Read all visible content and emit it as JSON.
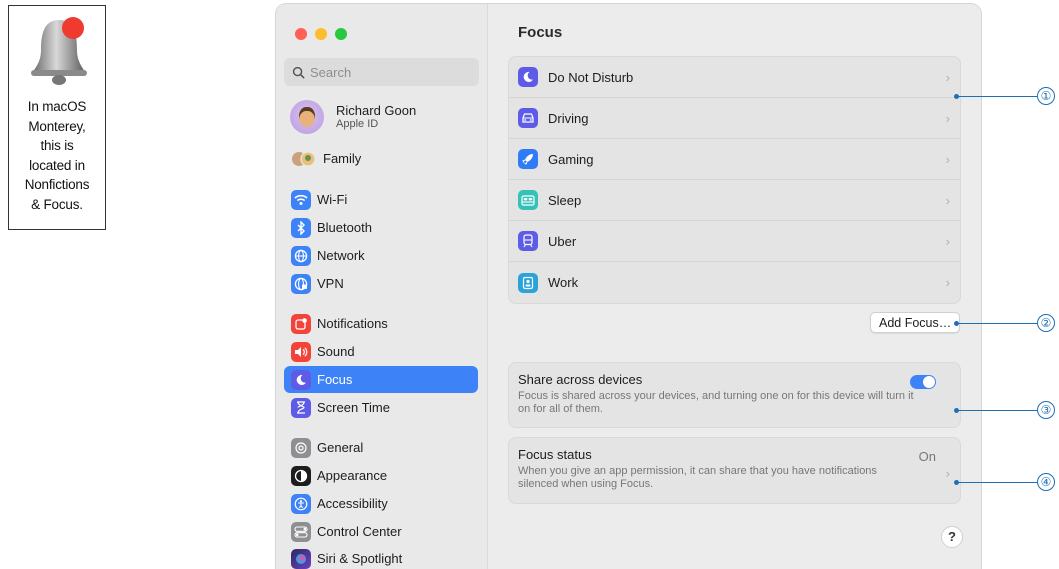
{
  "callout": {
    "text": "In macOS\nMonterey,\nthis is\nlocated in\nNonfictions\n& Focus."
  },
  "window": {
    "search_placeholder": "Search",
    "profile": {
      "name": "Richard Goon",
      "sub": "Apple ID"
    },
    "sidebar": [
      {
        "label": "Family",
        "icon": "family-icon"
      },
      {
        "label": "Wi-Fi",
        "icon": "wifi-icon",
        "color": "#3e82f7"
      },
      {
        "label": "Bluetooth",
        "icon": "bluetooth-icon",
        "color": "#3e82f7"
      },
      {
        "label": "Network",
        "icon": "network-icon",
        "color": "#3e82f7"
      },
      {
        "label": "VPN",
        "icon": "vpn-icon",
        "color": "#3e82f7"
      },
      {
        "label": "Notifications",
        "icon": "notifications-icon",
        "color": "#f2443a"
      },
      {
        "label": "Sound",
        "icon": "sound-icon",
        "color": "#f2443a"
      },
      {
        "label": "Focus",
        "icon": "focus-moon-icon",
        "color": "#5e5ce6",
        "active": true
      },
      {
        "label": "Screen Time",
        "icon": "hourglass-icon",
        "color": "#5e5ce6"
      },
      {
        "label": "General",
        "icon": "gear-icon",
        "color": "#8e8e93"
      },
      {
        "label": "Appearance",
        "icon": "appearance-icon",
        "color": "#1d1d1f"
      },
      {
        "label": "Accessibility",
        "icon": "accessibility-icon",
        "color": "#3e82f7"
      },
      {
        "label": "Control Center",
        "icon": "control-center-icon",
        "color": "#8e8e93"
      },
      {
        "label": "Siri & Spotlight",
        "icon": "siri-icon",
        "color": "#6f3fc4"
      }
    ]
  },
  "main": {
    "title": "Focus",
    "focus_modes": [
      {
        "label": "Do Not Disturb",
        "icon": "moon-icon",
        "color": "#5e5ce6"
      },
      {
        "label": "Driving",
        "icon": "car-icon",
        "color": "#5e5ce6"
      },
      {
        "label": "Gaming",
        "icon": "rocket-icon",
        "color": "#2f7cf6"
      },
      {
        "label": "Sleep",
        "icon": "bed-icon",
        "color": "#34c2b8"
      },
      {
        "label": "Uber",
        "icon": "train-icon",
        "color": "#5e5ce6"
      },
      {
        "label": "Work",
        "icon": "badge-icon",
        "color": "#2aa3d8"
      }
    ],
    "add_focus_label": "Add Focus…",
    "share": {
      "title": "Share across devices",
      "desc": "Focus is shared across your devices, and turning one on for this device will turn it on for all of them.",
      "enabled": true
    },
    "status": {
      "title": "Focus status",
      "value": "On",
      "desc": "When you give an app permission, it can share that you have notifications silenced when using Focus."
    },
    "help_label": "?"
  },
  "annotations": [
    "①",
    "②",
    "③",
    "④"
  ]
}
